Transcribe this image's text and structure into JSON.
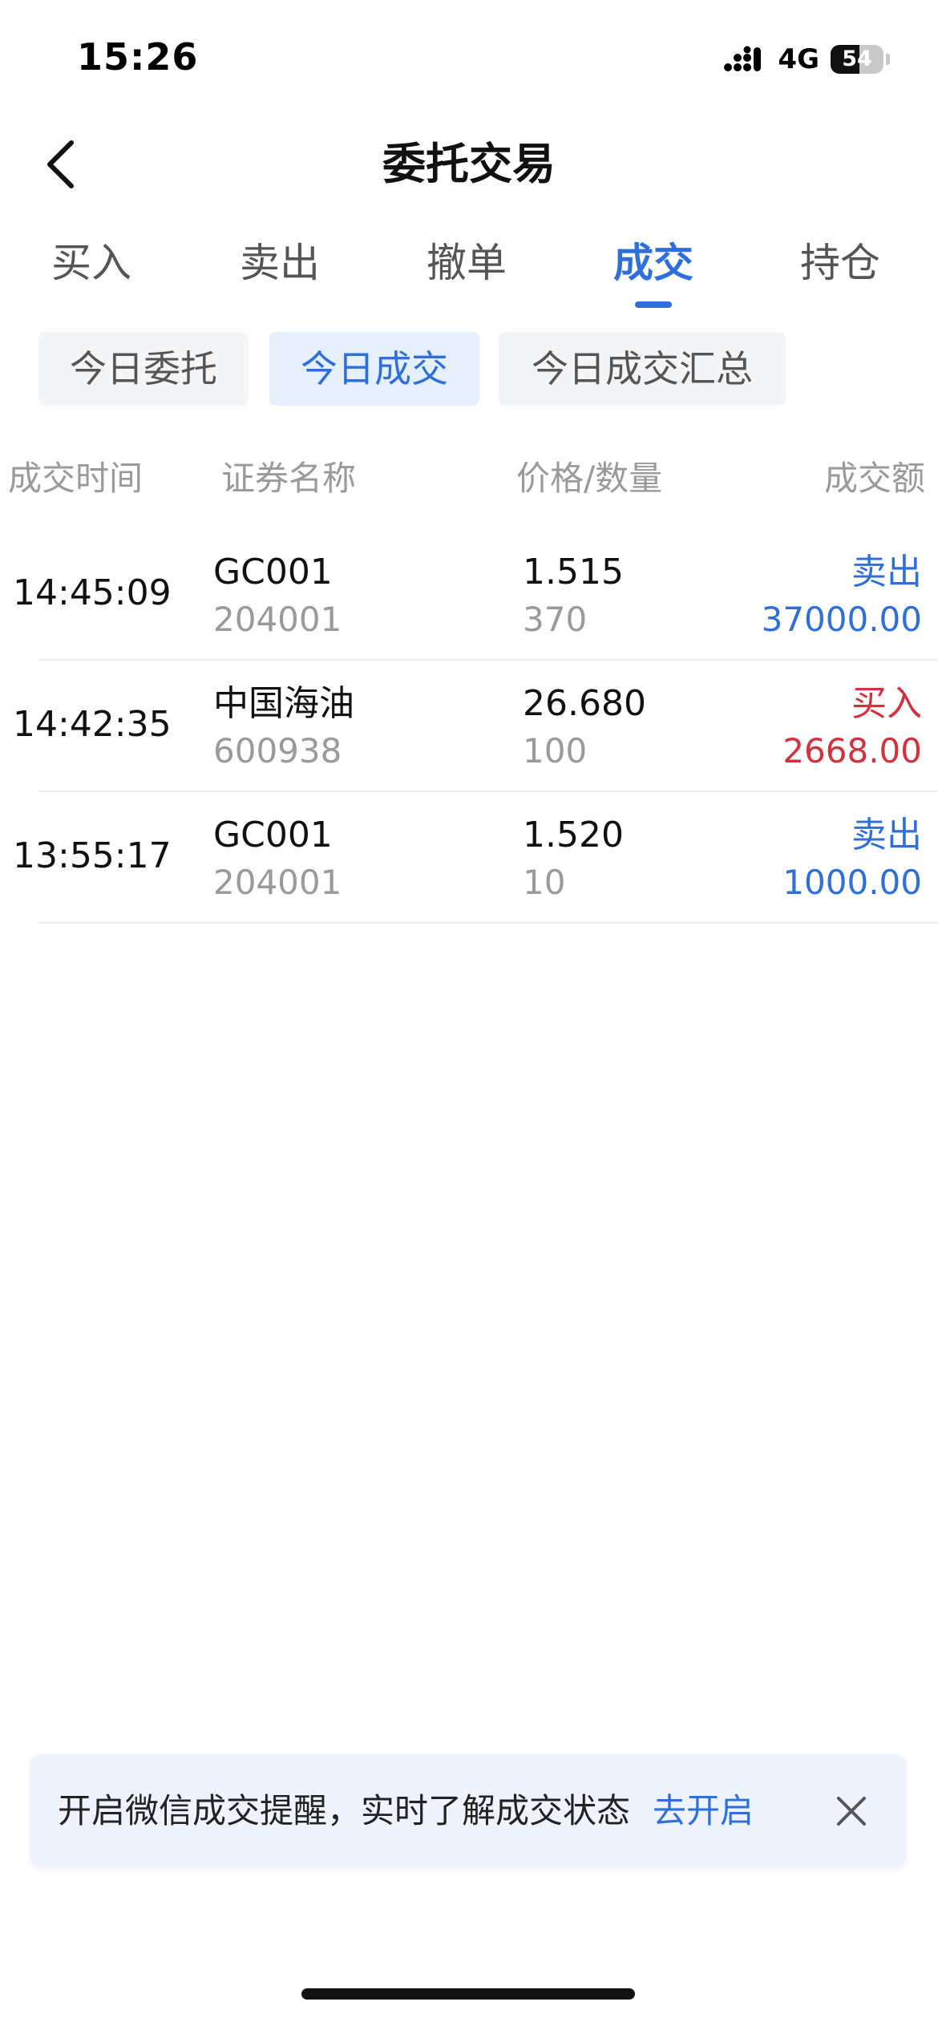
{
  "status_bar": {
    "time": "15:26",
    "network": "4G",
    "battery_percent": 54,
    "battery_label": "54"
  },
  "nav": {
    "title": "委托交易",
    "back_icon": "chevron-left-icon"
  },
  "main_tabs": [
    {
      "label": "买入",
      "active": false
    },
    {
      "label": "卖出",
      "active": false
    },
    {
      "label": "撤单",
      "active": false
    },
    {
      "label": "成交",
      "active": true
    },
    {
      "label": "持仓",
      "active": false
    }
  ],
  "sub_tabs": [
    {
      "label": "今日委托",
      "active": false
    },
    {
      "label": "今日成交",
      "active": true
    },
    {
      "label": "今日成交汇总",
      "active": false
    }
  ],
  "table": {
    "headers": {
      "time": "成交时间",
      "name": "证券名称",
      "price_qty": "价格/数量",
      "amount": "成交额"
    },
    "rows": [
      {
        "time": "14:45:09",
        "name": "GC001",
        "code": "204001",
        "price": "1.515",
        "quantity": "370",
        "side": "卖出",
        "amount": "37000.00"
      },
      {
        "time": "14:42:35",
        "name": "中国海油",
        "code": "600938",
        "price": "26.680",
        "quantity": "100",
        "side": "买入",
        "amount": "2668.00"
      },
      {
        "time": "13:55:17",
        "name": "GC001",
        "code": "204001",
        "price": "1.520",
        "quantity": "10",
        "side": "卖出",
        "amount": "1000.00"
      }
    ]
  },
  "banner": {
    "text": "开启微信成交提醒，实时了解成交状态",
    "link": "去开启",
    "close_icon": "close-icon"
  },
  "colors": {
    "accent": "#2f6fdc",
    "buy": "#d2313d",
    "sell": "#2f6fdc",
    "muted": "#9a9a9a"
  }
}
